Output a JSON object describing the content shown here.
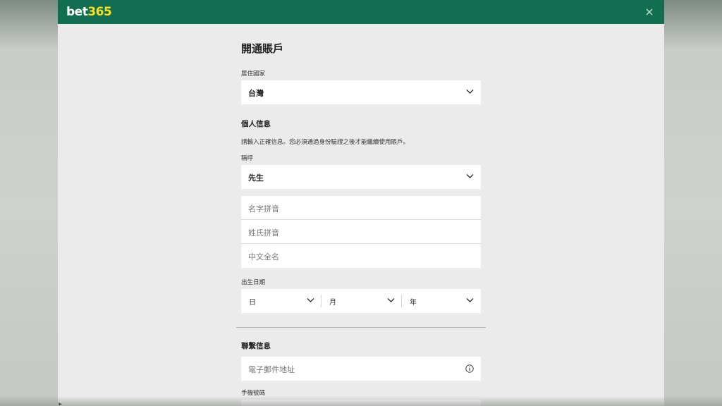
{
  "header": {
    "logo_part1": "bet",
    "logo_part2": "365",
    "close_label": "×"
  },
  "form": {
    "title": "開通賬戶",
    "country": {
      "label": "居住國家",
      "value": "台灣"
    },
    "personal": {
      "title": "個人信息",
      "description": "請輸入正確信息。您必須通過身份驗證之後才能繼續使用賬戶。",
      "salutation": {
        "label": "稱呼",
        "value": "先生"
      },
      "first_name_placeholder": "名字拼音",
      "last_name_placeholder": "姓氏拼音",
      "chinese_name_placeholder": "中文全名",
      "dob": {
        "label": "出生日期",
        "day": "日",
        "month": "月",
        "year": "年"
      }
    },
    "contact": {
      "title": "聯繫信息",
      "email_placeholder": "電子郵件地址",
      "phone_label": "手機號碼"
    }
  },
  "colors": {
    "header_bg": "#126e51",
    "logo_accent": "#ffdf1b",
    "panel_bg": "#eaebea"
  }
}
